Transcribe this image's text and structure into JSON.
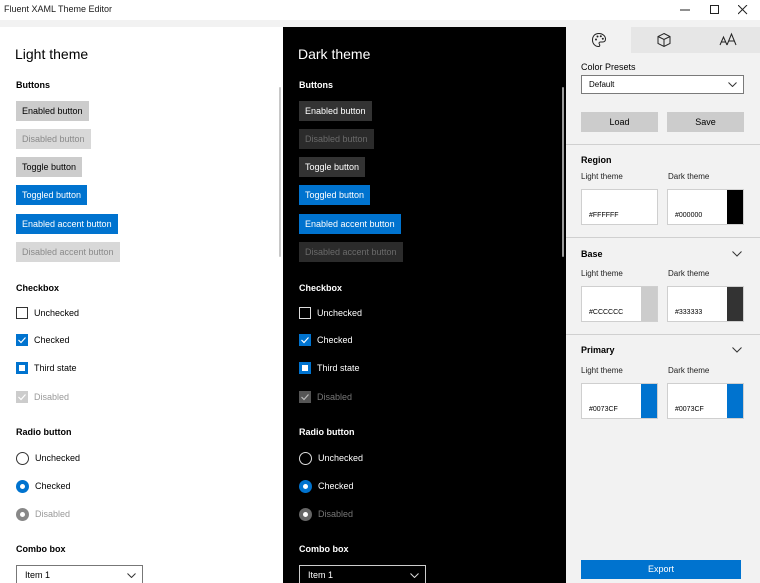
{
  "window": {
    "title": "Fluent XAML Theme Editor",
    "controls": [
      "minimize-icon",
      "maximize-icon",
      "close-icon"
    ]
  },
  "light": {
    "title": "Light theme",
    "buttons_header": "Buttons",
    "buttons": {
      "enabled": "Enabled button",
      "disabled": "Disabled button",
      "toggle": "Toggle button",
      "toggled": "Toggled button",
      "enabled_accent": "Enabled accent button",
      "disabled_accent": "Disabled accent button"
    },
    "checkbox_header": "Checkbox",
    "checkbox": {
      "unchecked": "Unchecked",
      "checked": "Checked",
      "third": "Third state",
      "disabled": "Disabled"
    },
    "radio_header": "Radio button",
    "radio": {
      "unchecked": "Unchecked",
      "checked": "Checked",
      "disabled": "Disabled"
    },
    "combo_header": "Combo box",
    "combo_value": "Item 1"
  },
  "dark": {
    "title": "Dark theme",
    "buttons_header": "Buttons",
    "buttons": {
      "enabled": "Enabled button",
      "disabled": "Disabled button",
      "toggle": "Toggle button",
      "toggled": "Toggled button",
      "enabled_accent": "Enabled accent button",
      "disabled_accent": "Disabled accent button"
    },
    "checkbox_header": "Checkbox",
    "checkbox": {
      "unchecked": "Unchecked",
      "checked": "Checked",
      "third": "Third state",
      "disabled": "Disabled"
    },
    "radio_header": "Radio button",
    "radio": {
      "unchecked": "Unchecked",
      "checked": "Checked",
      "disabled": "Disabled"
    },
    "combo_header": "Combo box",
    "combo_value": "Item 1"
  },
  "sidebar": {
    "tabs": [
      "palette-icon",
      "cube-icon",
      "font-size-icon"
    ],
    "active_tab": 0,
    "presets_label": "Color Presets",
    "presets_value": "Default",
    "load_label": "Load",
    "save_label": "Save",
    "region": {
      "title": "Region",
      "light_label": "Light theme",
      "dark_label": "Dark theme",
      "light_hex": "#FFFFFF",
      "dark_hex": "#000000"
    },
    "base": {
      "title": "Base",
      "light_label": "Light theme",
      "dark_label": "Dark theme",
      "light_hex": "#CCCCCC",
      "dark_hex": "#333333"
    },
    "primary": {
      "title": "Primary",
      "light_label": "Light theme",
      "dark_label": "Dark theme",
      "light_hex": "#0073CF",
      "dark_hex": "#0073CF"
    },
    "export_label": "Export"
  },
  "colors": {
    "accent": "#0073CF",
    "region_light": "#FFFFFF",
    "region_dark": "#000000",
    "base_light": "#CCCCCC",
    "base_dark": "#333333"
  }
}
